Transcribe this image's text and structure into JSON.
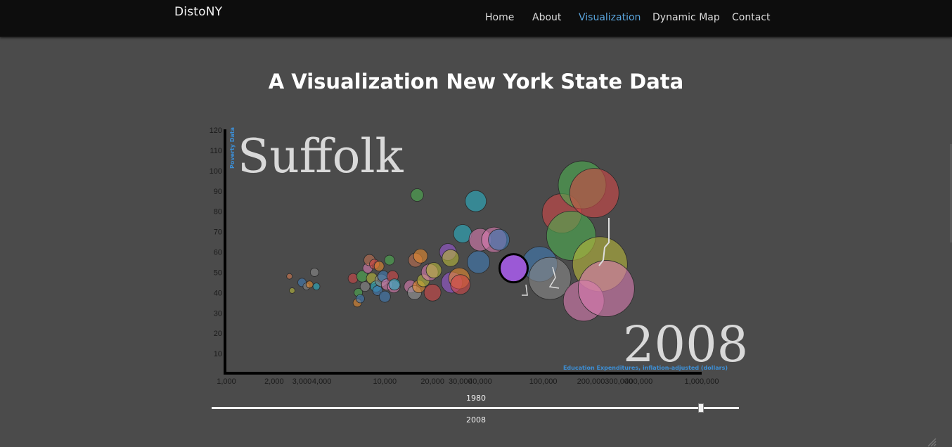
{
  "navbar": {
    "brand": "DistoNY",
    "items": [
      {
        "label": "Home",
        "active": false
      },
      {
        "label": "About",
        "active": false
      },
      {
        "label": "Visualization",
        "active": true
      },
      {
        "label": "Dynamic Map",
        "active": false
      },
      {
        "label": "Contact",
        "active": false
      }
    ],
    "active_color": "#5aa5dd"
  },
  "page": {
    "title": "A Visualization New York State Data"
  },
  "chart_data": {
    "type": "scatter",
    "highlight_label": "Suffolk",
    "year_label": "2008",
    "xlabel": "Education Expenditures, inflation-adjusted (dollars)",
    "ylabel": "Poverty Data",
    "x_scale": "log",
    "xlim": [
      1000,
      1000000
    ],
    "ylim": [
      0,
      120
    ],
    "x_ticks": [
      {
        "value": 1000,
        "label": "1,000"
      },
      {
        "value": 2000,
        "label": "2,000"
      },
      {
        "value": 3000,
        "label": "3,000"
      },
      {
        "value": 4000,
        "label": "4,000"
      },
      {
        "value": 10000,
        "label": "10,000"
      },
      {
        "value": 20000,
        "label": "20,000"
      },
      {
        "value": 30000,
        "label": "30,000"
      },
      {
        "value": 40000,
        "label": "40,000"
      },
      {
        "value": 100000,
        "label": "100,000"
      },
      {
        "value": 200000,
        "label": "200,000"
      },
      {
        "value": 300000,
        "label": "300,000"
      },
      {
        "value": 400000,
        "label": "400,000"
      },
      {
        "value": 1000000,
        "label": "1,000,000"
      }
    ],
    "y_ticks": [
      10,
      20,
      30,
      40,
      50,
      60,
      70,
      80,
      90,
      100,
      110,
      120
    ],
    "selected_point": {
      "name": "Suffolk",
      "x": 65000,
      "y": 52,
      "r": 20,
      "color": "#9b59d6"
    },
    "points": [
      {
        "x": 2500,
        "y": 48,
        "r": 4,
        "color": "#d67a4f"
      },
      {
        "x": 2600,
        "y": 41,
        "r": 4,
        "color": "#b7b83a"
      },
      {
        "x": 3000,
        "y": 45,
        "r": 6,
        "color": "#3f7cb6"
      },
      {
        "x": 3200,
        "y": 43,
        "r": 5,
        "color": "#888888"
      },
      {
        "x": 3350,
        "y": 44,
        "r": 5,
        "color": "#e68a2e"
      },
      {
        "x": 3600,
        "y": 50,
        "r": 6,
        "color": "#8a8a8a"
      },
      {
        "x": 3700,
        "y": 43,
        "r": 5,
        "color": "#2ab1c4"
      },
      {
        "x": 6300,
        "y": 47,
        "r": 7,
        "color": "#d24848"
      },
      {
        "x": 6700,
        "y": 35,
        "r": 6,
        "color": "#e68a2e"
      },
      {
        "x": 6800,
        "y": 40,
        "r": 6,
        "color": "#4caf50"
      },
      {
        "x": 7000,
        "y": 37,
        "r": 6,
        "color": "#3f7cb6"
      },
      {
        "x": 7200,
        "y": 48,
        "r": 8,
        "color": "#4caf50"
      },
      {
        "x": 7500,
        "y": 43,
        "r": 7,
        "color": "#8a8a8a"
      },
      {
        "x": 7800,
        "y": 52,
        "r": 7,
        "color": "#d87bb0"
      },
      {
        "x": 8000,
        "y": 56,
        "r": 8,
        "color": "#c07050"
      },
      {
        "x": 8300,
        "y": 47,
        "r": 8,
        "color": "#b7b83a"
      },
      {
        "x": 8600,
        "y": 54,
        "r": 7,
        "color": "#d24848"
      },
      {
        "x": 8800,
        "y": 43,
        "r": 8,
        "color": "#2ab1c4"
      },
      {
        "x": 9000,
        "y": 41,
        "r": 7,
        "color": "#3f7cb6"
      },
      {
        "x": 9200,
        "y": 53,
        "r": 7,
        "color": "#e68a2e"
      },
      {
        "x": 9500,
        "y": 46,
        "r": 9,
        "color": "#888888"
      },
      {
        "x": 9800,
        "y": 48,
        "r": 8,
        "color": "#3f7cb6"
      },
      {
        "x": 10000,
        "y": 38,
        "r": 8,
        "color": "#3f7cb6"
      },
      {
        "x": 10300,
        "y": 44,
        "r": 8,
        "color": "#d87bb0"
      },
      {
        "x": 10700,
        "y": 56,
        "r": 7,
        "color": "#4caf50"
      },
      {
        "x": 11200,
        "y": 48,
        "r": 8,
        "color": "#d24848"
      },
      {
        "x": 11400,
        "y": 43,
        "r": 9,
        "color": "#d87bb0"
      },
      {
        "x": 11500,
        "y": 44,
        "r": 8,
        "color": "#2ab1c4"
      },
      {
        "x": 14500,
        "y": 43,
        "r": 9,
        "color": "#d87bb0"
      },
      {
        "x": 15400,
        "y": 40,
        "r": 10,
        "color": "#999999"
      },
      {
        "x": 15600,
        "y": 56,
        "r": 10,
        "color": "#c07050"
      },
      {
        "x": 16000,
        "y": 88,
        "r": 9,
        "color": "#4caf50"
      },
      {
        "x": 16400,
        "y": 43,
        "r": 9,
        "color": "#e68a2e"
      },
      {
        "x": 16800,
        "y": 58,
        "r": 10,
        "color": "#e68a2e"
      },
      {
        "x": 17500,
        "y": 46,
        "r": 9,
        "color": "#b7b83a"
      },
      {
        "x": 19200,
        "y": 50,
        "r": 12,
        "color": "#d87bb0"
      },
      {
        "x": 20000,
        "y": 40,
        "r": 12,
        "color": "#d24848"
      },
      {
        "x": 20400,
        "y": 51,
        "r": 11,
        "color": "#b7b83a"
      },
      {
        "x": 25000,
        "y": 60,
        "r": 12,
        "color": "#9b59d6"
      },
      {
        "x": 26000,
        "y": 57,
        "r": 12,
        "color": "#b7b83a"
      },
      {
        "x": 26500,
        "y": 45,
        "r": 15,
        "color": "#9b59d6"
      },
      {
        "x": 29500,
        "y": 47,
        "r": 15,
        "color": "#e68a2e"
      },
      {
        "x": 30000,
        "y": 44,
        "r": 14,
        "color": "#d24848"
      },
      {
        "x": 31000,
        "y": 69,
        "r": 13,
        "color": "#2ab1c4"
      },
      {
        "x": 37500,
        "y": 85,
        "r": 15,
        "color": "#2ab1c4"
      },
      {
        "x": 39000,
        "y": 55,
        "r": 16,
        "color": "#3f7cb6"
      },
      {
        "x": 40000,
        "y": 66,
        "r": 16,
        "color": "#d87bb0"
      },
      {
        "x": 49000,
        "y": 66,
        "r": 18,
        "color": "#d87bb0"
      },
      {
        "x": 52500,
        "y": 66,
        "r": 15,
        "color": "#3f7cb6"
      },
      {
        "x": 95000,
        "y": 54,
        "r": 25,
        "color": "#3f7cb6"
      },
      {
        "x": 110000,
        "y": 47,
        "r": 30,
        "color": "#888888"
      },
      {
        "x": 131000,
        "y": 79,
        "r": 28,
        "color": "#d24848"
      },
      {
        "x": 150000,
        "y": 68,
        "r": 35,
        "color": "#4caf50"
      },
      {
        "x": 176000,
        "y": 93,
        "r": 34,
        "color": "#4caf50"
      },
      {
        "x": 210000,
        "y": 89,
        "r": 35,
        "color": "#d24848"
      },
      {
        "x": 228000,
        "y": 54,
        "r": 39,
        "color": "#b7b83a"
      },
      {
        "x": 180000,
        "y": 36,
        "r": 29,
        "color": "#d87bb0"
      },
      {
        "x": 250000,
        "y": 42,
        "r": 40,
        "color": "#d87bb0"
      }
    ]
  },
  "slider": {
    "min_label": "1980",
    "value_label": "2008",
    "value": 2008,
    "min": 1980,
    "max": 2010
  }
}
